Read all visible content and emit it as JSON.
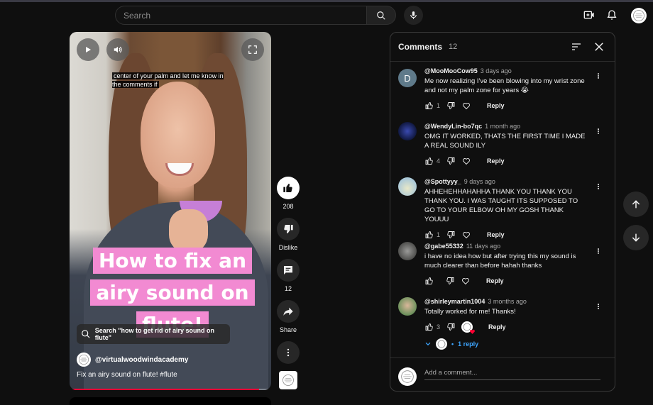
{
  "header": {
    "search_placeholder": "Search"
  },
  "icons": {
    "search": "search-icon",
    "mic": "mic-icon",
    "create": "create-video-icon",
    "notifications": "bell-icon",
    "play": "play-icon",
    "volume": "volume-icon",
    "fullscreen": "fullscreen-icon"
  },
  "video": {
    "caption": "center of your palm and let me know in the comments if",
    "overlay_title": "How to fix an airy sound on flute!",
    "related_search": "Search \"how to get rid of airy sound on flute\"",
    "channel": "@virtualwoodwindacademy",
    "description": "Fix an airy sound on flute! #flute",
    "progress": 0.94
  },
  "actions": {
    "like_count": "208",
    "dislike_label": "Dislike",
    "comments_count": "12",
    "share_label": "Share"
  },
  "comments_panel": {
    "title": "Comments",
    "count": "12",
    "add_placeholder": "Add a comment...",
    "reply_label": "Reply",
    "replies_link": "1 reply",
    "items": [
      {
        "user": "@MooMooCow95",
        "time": "3 days ago",
        "text": "Me now realizing I've been blowing into my wrist zone and not my palm zone for years 😭",
        "likes": "1",
        "avatar_letter": "D",
        "avatar_color": "#5f7a8a"
      },
      {
        "user": "@WendyLin-bo7qc",
        "time": "1 month ago",
        "text": "OMG IT WORKED, THATS THE FIRST TIME I MADE A REAL SOUND ILY",
        "likes": "4",
        "avatar_letter": "",
        "avatar_color": "#1c2a6e"
      },
      {
        "user": "@Spottyyy_",
        "time": "9 days ago",
        "text": "AHHEHEHHAHAHHA THANK YOU THANK YOU THANK YOU. I WAS TAUGHT ITS SUPPOSED TO GO TO YOUR ELBOW OH MY GOSH THANK YOUUU",
        "likes": "1",
        "avatar_letter": "",
        "avatar_color": "#a9c8d8"
      },
      {
        "user": "@gabe55332",
        "time": "11 days ago",
        "text": "i have no idea how but after trying this my sound is much clearer than before hahah thanks",
        "likes": "",
        "avatar_letter": "",
        "avatar_color": "#7a7a78"
      },
      {
        "user": "@shirleymartin1004",
        "time": "3 months ago",
        "text": "Totally worked for me! Thanks!",
        "likes": "3",
        "avatar_letter": "",
        "avatar_color": "#6a8f5a"
      }
    ]
  }
}
